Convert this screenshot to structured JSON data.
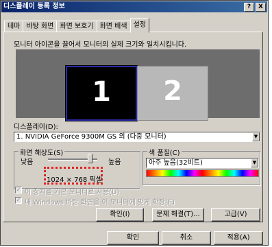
{
  "window": {
    "title": "디스플레이 등록 정보",
    "help_btn": "?",
    "close_btn": "X"
  },
  "tabs": [
    {
      "label": "테마",
      "active": false
    },
    {
      "label": "바탕 화면",
      "active": false
    },
    {
      "label": "화면 보호기",
      "active": false
    },
    {
      "label": "화면 배색",
      "active": false
    },
    {
      "label": "설정",
      "active": true
    }
  ],
  "instruction": "모니터 아이콘을 끌어서 모니터의 실제 크기와 일치시킵니다.",
  "monitors": [
    {
      "number": "1",
      "selected": true
    },
    {
      "number": "2",
      "selected": false
    }
  ],
  "display": {
    "label": "디스플레이(D):",
    "value": "1. NVIDIA GeForce 9300M GS 의 (다중 모니터)"
  },
  "resolution": {
    "legend": "화면 해상도(S)",
    "low": "낮음",
    "high": "높음",
    "value": "1024 × 768 픽셀",
    "slider_fraction": 0.82
  },
  "color_quality": {
    "legend": "색 품질(C)",
    "value": "아주 높음(32비트)"
  },
  "checkboxes": [
    {
      "label": "이 장치를 기본 모니터로 사용(U)",
      "checked": true,
      "enabled": false
    },
    {
      "label": "내 Windows 바탕 화면을 이 모니터에 맞게 확장(E)",
      "checked": true,
      "enabled": false
    }
  ],
  "panel_buttons": {
    "identify": "확인(I)",
    "troubleshoot": "문제 해결(T)...",
    "advanced": "고급(V)"
  },
  "dialog_buttons": {
    "ok": "확인",
    "cancel": "취소",
    "apply": "적용(A)"
  },
  "colors": {
    "title_bar": "#0a246a",
    "highlight_box": "#e02020",
    "monitor_bg": "#6d6d6d"
  }
}
